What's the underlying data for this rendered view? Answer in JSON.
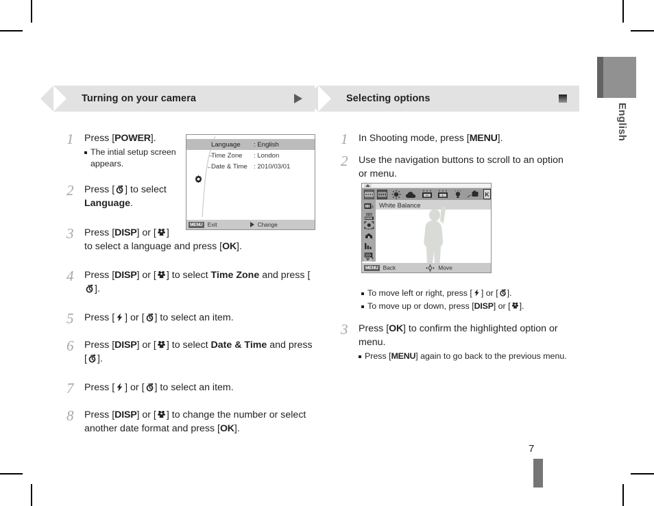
{
  "page": {
    "number": "7",
    "language_tab": "English"
  },
  "sections": [
    {
      "id": "turning-on",
      "title": "Turning on your camera",
      "marker_icon": "play-triangle-icon",
      "steps": [
        {
          "num": "1",
          "text_parts": [
            "Press [",
            "POWER",
            "]."
          ],
          "bullets": [
            "The intial setup screen appears."
          ]
        },
        {
          "num": "2",
          "text_parts": [
            "Press [",
            "timer-icon",
            "] to select ",
            "Language",
            "."
          ]
        },
        {
          "num": "3",
          "text_parts": [
            "Press [",
            "DISP",
            "] or [",
            "macro-icon",
            "] to select a language and press [",
            "OK",
            "]."
          ]
        },
        {
          "num": "4",
          "text_parts": [
            "Press [",
            "DISP",
            "] or [",
            "macro-icon",
            "] to select ",
            "Time Zone",
            " and press [",
            "timer-icon",
            "]."
          ]
        },
        {
          "num": "5",
          "text_parts": [
            "Press [",
            "flash-icon",
            "] or [",
            "timer-icon",
            "] to select an item."
          ]
        },
        {
          "num": "6",
          "text_parts": [
            "Press [",
            "DISP",
            "] or [",
            "macro-icon",
            "] to select ",
            "Date & Time",
            " and press [",
            "timer-icon",
            "]."
          ]
        },
        {
          "num": "7",
          "text_parts": [
            "Press [",
            "flash-icon",
            "] or [",
            "timer-icon",
            "] to select an item."
          ]
        },
        {
          "num": "8",
          "text_parts": [
            "Press [",
            "DISP",
            "] or [",
            "macro-icon",
            "] to change the number or select another date format and press [",
            "OK",
            "]."
          ]
        }
      ]
    },
    {
      "id": "selecting-options",
      "title": "Selecting options",
      "marker_icon": "gradient-square-icon",
      "steps": [
        {
          "num": "1",
          "text_parts": [
            "In Shooting mode, press [",
            "MENU",
            "]."
          ]
        },
        {
          "num": "2",
          "text_parts": [
            "Use the navigation buttons to scroll to an option or menu."
          ],
          "bullets_after_image": [
            "To move left or right, press [flash-icon] or [timer-icon].",
            "To move up or down, press [DISP] or [macro-icon]."
          ]
        },
        {
          "num": "3",
          "text_parts": [
            "Press [",
            "OK",
            "] to confirm the highlighted option or menu."
          ],
          "bullets": [
            "Press [MENU] again to go back to the previous menu."
          ]
        }
      ]
    }
  ],
  "setup_screen": {
    "rows": [
      {
        "label": "Language",
        "value": ": English",
        "selected": true
      },
      {
        "label": "Time Zone",
        "value": ": London",
        "selected": false
      },
      {
        "label": "Date & Time",
        "value": ": 2010/03/01",
        "selected": false
      }
    ],
    "footer": {
      "menu_tag": "MENU",
      "left_label": "Exit",
      "right_icon": "right-triangle-icon",
      "right_label": "Change"
    },
    "side_icon": "gear-icon"
  },
  "menu_screen": {
    "title": "White Balance",
    "top_icons": [
      "wb-auto-icon",
      "wb-daylight-icon",
      "wb-sunny-icon",
      "wb-cloudy-icon",
      "wb-fluorescent-h-icon",
      "wb-fluorescent-l-icon",
      "wb-tungsten-icon",
      "wb-custom-icon",
      "wb-kelvin-icon"
    ],
    "selected_top_icon_index": 1,
    "side_icons": [
      "exposure-value-icon",
      "iso-icon",
      "face-detection-off-icon",
      "smart-filter-icon",
      "image-adjust-icon",
      "focus-area-icon"
    ],
    "footer": {
      "menu_tag": "MENU",
      "left_label": "Back",
      "nav_icon": "navigation-pad-icon",
      "right_label": "Move"
    }
  },
  "colors": {
    "banner_bg": "#e2e2e2",
    "step_number": "#a7a7a7",
    "text": "#231f20",
    "tab_gray": "#919191",
    "tab_edge": "#636363"
  }
}
